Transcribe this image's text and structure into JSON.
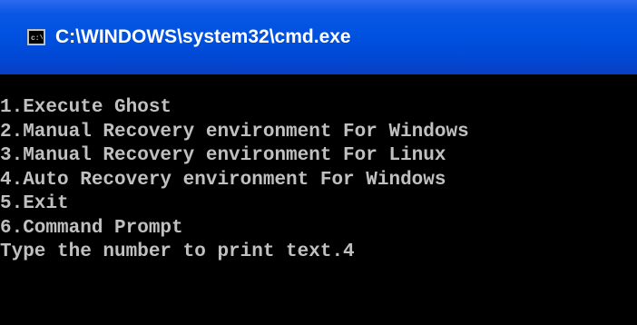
{
  "window": {
    "title": "C:\\WINDOWS\\system32\\cmd.exe",
    "icon": "cmd-icon"
  },
  "console": {
    "lines": [
      "1.Execute Ghost",
      "2.Manual Recovery environment For Windows",
      "3.Manual Recovery environment For Linux",
      "4.Auto Recovery environment For Windows",
      "5.Exit",
      "6.Command Prompt",
      "Type the number to print text.4"
    ]
  },
  "colors": {
    "titlebar": "#0052e0",
    "console_bg": "#000000",
    "console_text": "#c0c0c0"
  }
}
